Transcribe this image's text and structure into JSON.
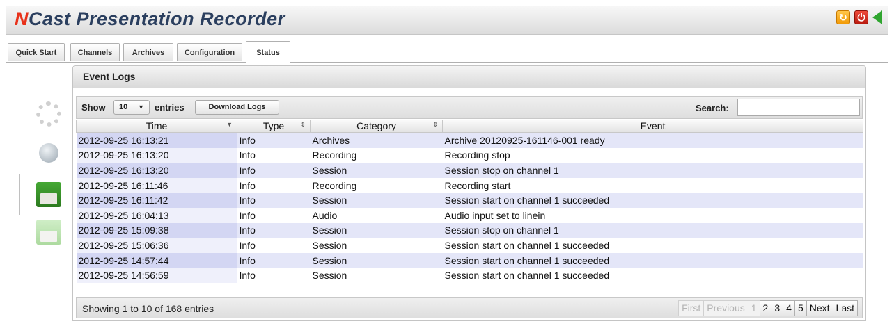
{
  "header": {
    "brand_n": "N",
    "brand_rest": "Cast Presentation Recorder",
    "icons": [
      "refresh-icon",
      "power-icon",
      "back-arrow-icon"
    ]
  },
  "tabs": [
    {
      "label": "Quick Start"
    },
    {
      "label": "Channels"
    },
    {
      "label": "Archives"
    },
    {
      "label": "Configuration"
    },
    {
      "label": "Status",
      "active": true
    }
  ],
  "sidebar": {
    "icons": [
      "gear-icon",
      "globe-icon",
      "archive-drawer-icon",
      "archive-drawer-icon"
    ],
    "selected": 2
  },
  "panel": {
    "title": "Event Logs",
    "show_label": "Show",
    "page_size": "10",
    "entries_label": "entries",
    "download_label": "Download Logs",
    "search_label": "Search:",
    "search_value": ""
  },
  "table": {
    "columns": [
      "Time",
      "Type",
      "Category",
      "Event"
    ],
    "rows": [
      [
        "2012-09-25 16:13:21",
        "Info",
        "Archives",
        "Archive 20120925-161146-001 ready"
      ],
      [
        "2012-09-25 16:13:20",
        "Info",
        "Recording",
        "Recording stop"
      ],
      [
        "2012-09-25 16:13:20",
        "Info",
        "Session",
        "Session stop on channel 1"
      ],
      [
        "2012-09-25 16:11:46",
        "Info",
        "Recording",
        "Recording start"
      ],
      [
        "2012-09-25 16:11:42",
        "Info",
        "Session",
        "Session start on channel 1 succeeded"
      ],
      [
        "2012-09-25 16:04:13",
        "Info",
        "Audio",
        "Audio input set to linein"
      ],
      [
        "2012-09-25 15:09:38",
        "Info",
        "Session",
        "Session stop on channel 1"
      ],
      [
        "2012-09-25 15:06:36",
        "Info",
        "Session",
        "Session start on channel 1 succeeded"
      ],
      [
        "2012-09-25 14:57:44",
        "Info",
        "Session",
        "Session start on channel 1 succeeded"
      ],
      [
        "2012-09-25 14:56:59",
        "Info",
        "Session",
        "Session start on channel 1 succeeded"
      ]
    ]
  },
  "footer": {
    "info": "Showing 1 to 10 of 168 entries",
    "pager": {
      "first": "First",
      "previous": "Previous",
      "pages": [
        "1",
        "2",
        "3",
        "4",
        "5"
      ],
      "current": "1",
      "next": "Next",
      "last": "Last"
    }
  },
  "colors": {
    "brand_red": "#e8311a",
    "brand_navy": "#2b3f5f",
    "odd_row": "#e4e6f8",
    "sorted_column": "#d3d6f3"
  }
}
